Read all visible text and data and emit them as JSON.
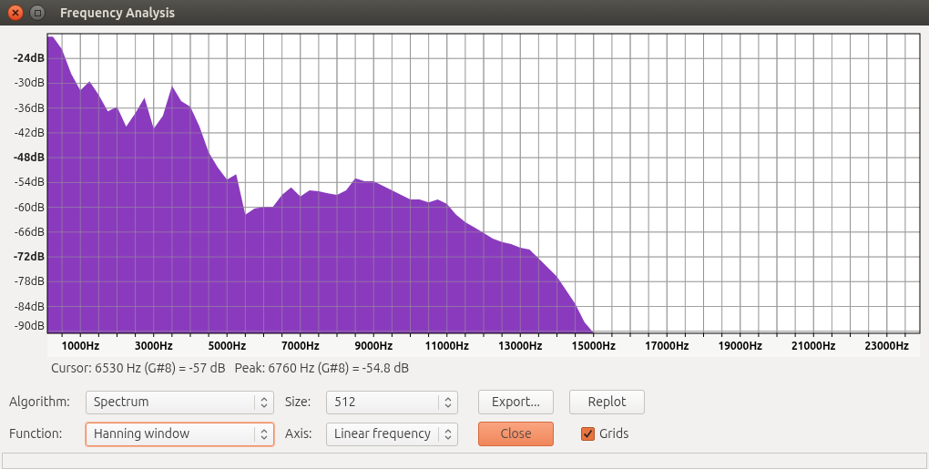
{
  "window": {
    "title": "Frequency Analysis"
  },
  "spectrum": {
    "chart_data": {
      "type": "area",
      "grid": true,
      "x": [
        250,
        500,
        750,
        1000,
        1250,
        1500,
        1750,
        2000,
        2250,
        2500,
        2750,
        3000,
        3250,
        3500,
        3750,
        4000,
        4250,
        4500,
        4750,
        5000,
        5250,
        5500,
        5750,
        6000,
        6250,
        6500,
        6750,
        7000,
        7250,
        7500,
        7750,
        8000,
        8250,
        8500,
        8750,
        9000,
        9250,
        9500,
        9750,
        10000,
        10250,
        10500,
        10750,
        11000,
        11250,
        11500,
        11750,
        12000,
        12250,
        12500,
        12750,
        13000,
        13250,
        13500,
        13750,
        14000,
        14250,
        14500,
        14750,
        15000
      ],
      "series": [
        {
          "color": "#8a3bbd",
          "values": [
            -18.7,
            -21.8,
            -27.7,
            -31.7,
            -29.5,
            -32.8,
            -36.8,
            -35.7,
            -40.5,
            -37.2,
            -33.5,
            -41,
            -37.9,
            -30.6,
            -34.3,
            -35.7,
            -40.5,
            -46.7,
            -50.4,
            -53.3,
            -52,
            -61.8,
            -60.3,
            -59.9,
            -59.9,
            -57,
            -55.2,
            -57.4,
            -55.9,
            -56.1,
            -56.6,
            -57,
            -55.9,
            -53,
            -53.7,
            -53.7,
            -54.8,
            -55.9,
            -57,
            -58.1,
            -58.1,
            -58.8,
            -58.1,
            -59.2,
            -61.8,
            -63.6,
            -64.9,
            -66.2,
            -67.6,
            -68.4,
            -68.9,
            -69.8,
            -70.2,
            -72.4,
            -74.6,
            -76.8,
            -80.1,
            -83.4,
            -87.8,
            -90.4
          ]
        }
      ],
      "xlim": [
        100,
        23900
      ],
      "ylim": [
        -90.5,
        -18
      ],
      "xticks": [
        {
          "value": 1000,
          "label": "1000Hz"
        },
        {
          "value": 3000,
          "label": "3000Hz"
        },
        {
          "value": 5000,
          "label": "5000Hz"
        },
        {
          "value": 7000,
          "label": "7000Hz"
        },
        {
          "value": 9000,
          "label": "9000Hz"
        },
        {
          "value": 11000,
          "label": "11000Hz"
        },
        {
          "value": 13000,
          "label": "13000Hz"
        },
        {
          "value": 15000,
          "label": "15000Hz"
        },
        {
          "value": 17000,
          "label": "17000Hz"
        },
        {
          "value": 19000,
          "label": "19000Hz"
        },
        {
          "value": 21000,
          "label": "21000Hz"
        },
        {
          "value": 23000,
          "label": "23000Hz"
        }
      ],
      "yticks": [
        {
          "value": -24,
          "label": "-24dB"
        },
        {
          "value": -30,
          "label": "-30dB"
        },
        {
          "value": -36,
          "label": "-36dB"
        },
        {
          "value": -42,
          "label": "-42dB"
        },
        {
          "value": -48,
          "label": "-48dB"
        },
        {
          "value": -54,
          "label": "-54dB"
        },
        {
          "value": -60,
          "label": "-60dB"
        },
        {
          "value": -66,
          "label": "-66dB"
        },
        {
          "value": -72,
          "label": "-72dB"
        },
        {
          "value": -78,
          "label": "-78dB"
        },
        {
          "value": -84,
          "label": "-84dB"
        },
        {
          "value": -90,
          "label": "-90dB"
        }
      ]
    }
  },
  "readout": {
    "cursor": "Cursor: 6530 Hz (G#8) = -57 dB",
    "peak": "Peak: 6760 Hz (G#8) = -54.8 dB"
  },
  "rows": [
    {
      "label": "Algorithm:",
      "combo": {
        "value": "Spectrum",
        "focused": false
      },
      "label2": "Size:",
      "combo2": {
        "value": "512",
        "focused": false
      },
      "button": {
        "label": "Export...",
        "kind": "normal"
      },
      "extra": {
        "kind": "button",
        "label": "Replot"
      }
    },
    {
      "label": "Function:",
      "combo": {
        "value": "Hanning window",
        "focused": true
      },
      "label2": "Axis:",
      "combo2": {
        "value": "Linear frequency",
        "focused": false
      },
      "button": {
        "label": "Close",
        "kind": "suggested"
      },
      "extra": {
        "kind": "checkbox",
        "label": "Grids",
        "checked": true
      }
    }
  ]
}
